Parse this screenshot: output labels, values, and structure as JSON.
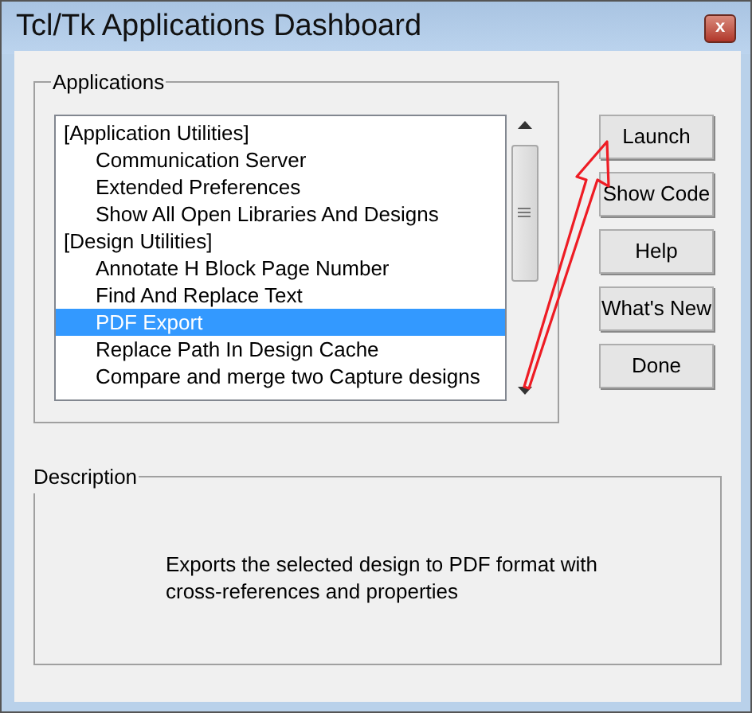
{
  "window": {
    "title": "Tcl/Tk Applications Dashboard",
    "close": "x"
  },
  "applications": {
    "label": "Applications",
    "items": [
      {
        "text": "[Application Utilities]",
        "kind": "group",
        "selected": false
      },
      {
        "text": "Communication Server",
        "kind": "app",
        "selected": false
      },
      {
        "text": "Extended Preferences",
        "kind": "app",
        "selected": false
      },
      {
        "text": "Show All Open Libraries And Designs",
        "kind": "app",
        "selected": false
      },
      {
        "text": "[Design Utilities]",
        "kind": "group",
        "selected": false
      },
      {
        "text": "Annotate H Block Page Number",
        "kind": "app",
        "selected": false
      },
      {
        "text": "Find And Replace Text",
        "kind": "app",
        "selected": false
      },
      {
        "text": "PDF Export",
        "kind": "app",
        "selected": true
      },
      {
        "text": "Replace Path In Design Cache",
        "kind": "app",
        "selected": false
      },
      {
        "text": "Compare and merge two Capture designs",
        "kind": "app",
        "selected": false
      }
    ]
  },
  "buttons": [
    "Launch",
    "Show Code",
    "Help",
    "What's New",
    "Done"
  ],
  "description": {
    "label": "Description",
    "text": "Exports the selected design to PDF format with cross-references and properties"
  }
}
